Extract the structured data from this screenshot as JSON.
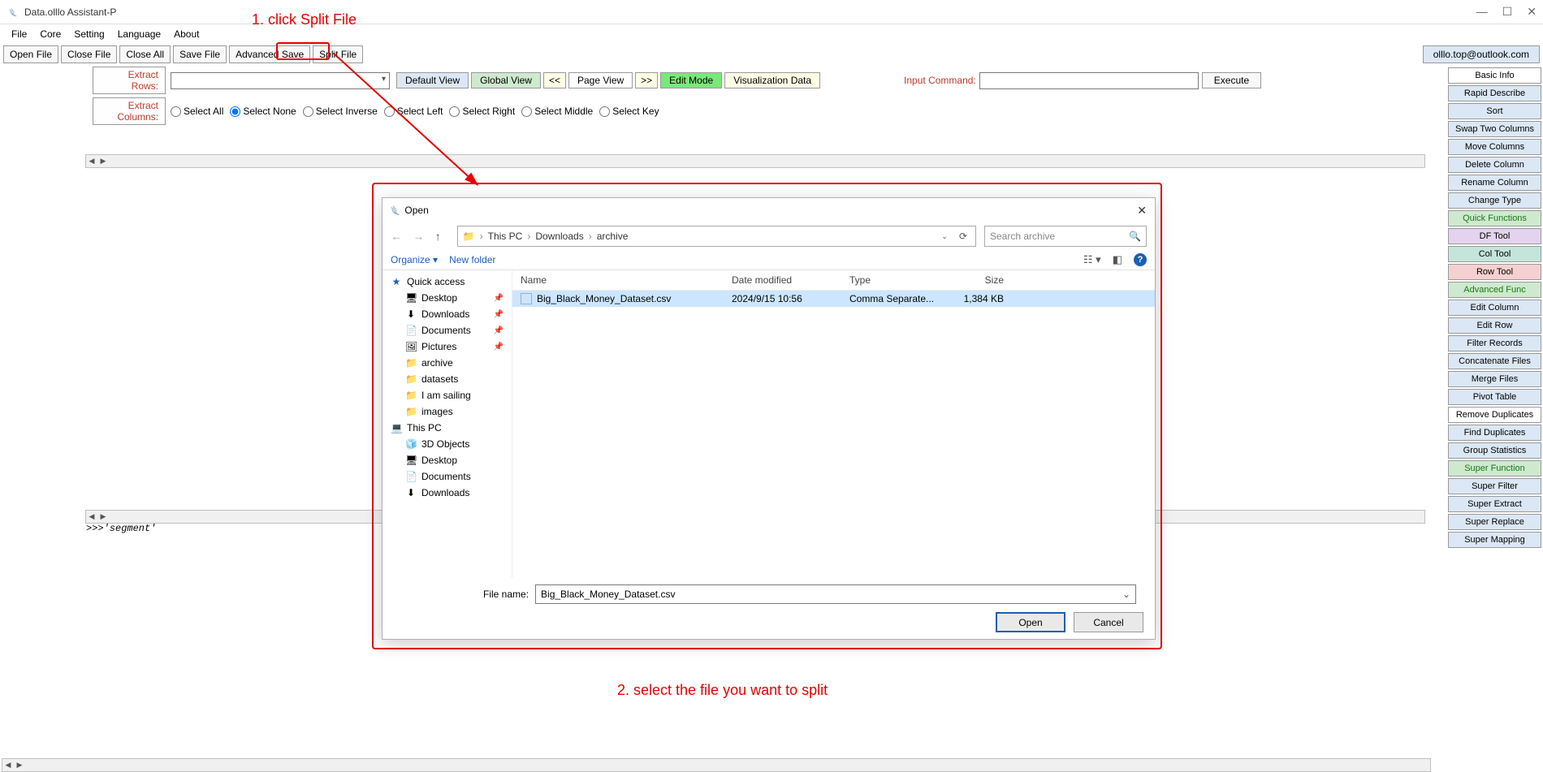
{
  "window": {
    "title": "Data.olllo Assistant-P"
  },
  "menus": [
    "File",
    "Core",
    "Setting",
    "Language",
    "About"
  ],
  "toolbar": [
    "Open File",
    "Close File",
    "Close All",
    "Save File",
    "Advanced Save",
    "Split File"
  ],
  "account": "olllo.top@outlook.com",
  "filters": {
    "rows_label": "Extract Rows:",
    "cols_label": "Extract Columns:",
    "view_default": "Default View",
    "view_global": "Global View",
    "view_prev": "<<",
    "view_page": "Page View",
    "view_next": ">>",
    "view_edit": "Edit Mode",
    "view_viz": "Visualization Data",
    "input_cmd_label": "Input Command:",
    "execute": "Execute",
    "radios": [
      "Select All",
      "Select None",
      "Select Inverse",
      "Select Left",
      "Select Right",
      "Select Middle",
      "Select Key"
    ],
    "radio_checked_index": 1
  },
  "right_panel": [
    {
      "label": "Basic Info",
      "cls": "alt-white"
    },
    {
      "label": "Rapid Describe",
      "cls": ""
    },
    {
      "label": "Sort",
      "cls": ""
    },
    {
      "label": "Swap Two Columns",
      "cls": ""
    },
    {
      "label": "Move Columns",
      "cls": ""
    },
    {
      "label": "Delete Column",
      "cls": ""
    },
    {
      "label": "Rename Column",
      "cls": ""
    },
    {
      "label": "Change Type",
      "cls": ""
    },
    {
      "label": "Quick Functions",
      "cls": "alt-green"
    },
    {
      "label": "DF Tool",
      "cls": "alt-purple"
    },
    {
      "label": "Col Tool",
      "cls": "alt-teal"
    },
    {
      "label": "Row Tool",
      "cls": "alt-pink"
    },
    {
      "label": "Advanced Func",
      "cls": "alt-green"
    },
    {
      "label": "Edit Column",
      "cls": ""
    },
    {
      "label": "Edit Row",
      "cls": ""
    },
    {
      "label": "Filter Records",
      "cls": ""
    },
    {
      "label": "Concatenate Files",
      "cls": ""
    },
    {
      "label": "Merge Files",
      "cls": ""
    },
    {
      "label": "Pivot Table",
      "cls": ""
    },
    {
      "label": "Remove Duplicates",
      "cls": "alt-white"
    },
    {
      "label": "Find Duplicates",
      "cls": ""
    },
    {
      "label": "Group Statistics",
      "cls": ""
    },
    {
      "label": "Super Function",
      "cls": "alt-green"
    },
    {
      "label": "Super Filter",
      "cls": ""
    },
    {
      "label": "Super Extract",
      "cls": ""
    },
    {
      "label": "Super Replace",
      "cls": ""
    },
    {
      "label": "Super Mapping",
      "cls": ""
    }
  ],
  "console": ">>>'segment'",
  "annotations": {
    "step1": "1. click Split File",
    "step2": "2. select the file you want to split"
  },
  "dialog": {
    "title": "Open",
    "crumbs": [
      "This PC",
      "Downloads",
      "archive"
    ],
    "search_placeholder": "Search archive",
    "organize": "Organize ▾",
    "new_folder": "New folder",
    "nav_tree": [
      {
        "label": "Quick access",
        "icon": "★",
        "cls": "qa",
        "level": 1
      },
      {
        "label": "Desktop",
        "icon": "🖥",
        "level": 2,
        "pin": true
      },
      {
        "label": "Downloads",
        "icon": "⬇",
        "level": 2,
        "pin": true
      },
      {
        "label": "Documents",
        "icon": "📄",
        "level": 2,
        "pin": true
      },
      {
        "label": "Pictures",
        "icon": "🖼",
        "level": 2,
        "pin": true
      },
      {
        "label": "archive",
        "icon": "📁",
        "level": 2
      },
      {
        "label": "datasets",
        "icon": "📁",
        "level": 2
      },
      {
        "label": "I am sailing",
        "icon": "📁",
        "level": 2
      },
      {
        "label": "images",
        "icon": "📁",
        "level": 2
      },
      {
        "label": "This PC",
        "icon": "💻",
        "level": 1
      },
      {
        "label": "3D Objects",
        "icon": "🧊",
        "level": 2
      },
      {
        "label": "Desktop",
        "icon": "🖥",
        "level": 2
      },
      {
        "label": "Documents",
        "icon": "📄",
        "level": 2
      },
      {
        "label": "Downloads",
        "icon": "⬇",
        "level": 2
      }
    ],
    "columns": {
      "name": "Name",
      "date": "Date modified",
      "type": "Type",
      "size": "Size"
    },
    "row": {
      "name": "Big_Black_Money_Dataset.csv",
      "date": "2024/9/15 10:56",
      "type": "Comma Separate...",
      "size": "1,384 KB"
    },
    "file_name_label": "File name:",
    "file_name_value": "Big_Black_Money_Dataset.csv",
    "open": "Open",
    "cancel": "Cancel"
  }
}
